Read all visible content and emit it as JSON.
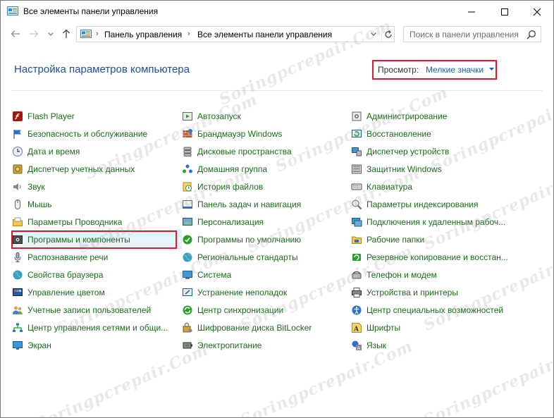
{
  "window": {
    "title": "Все элементы панели управления",
    "icon": "control-panel-icon"
  },
  "address_bar": {
    "breadcrumbs": [
      "Панель управления",
      "Все элементы панели управления"
    ],
    "search_placeholder": "Поиск в панели управления"
  },
  "header": {
    "title": "Настройка параметров компьютера",
    "view_label": "Просмотр:",
    "view_value": "Мелкие значки"
  },
  "columns": [
    [
      {
        "label": "Flash Player",
        "icon": "flash-player-icon"
      },
      {
        "label": "Безопасность и обслуживание",
        "icon": "flag-icon"
      },
      {
        "label": "Дата и время",
        "icon": "clock-icon"
      },
      {
        "label": "Диспетчер учетных данных",
        "icon": "credential-vault-icon"
      },
      {
        "label": "Звук",
        "icon": "speaker-icon"
      },
      {
        "label": "Мышь",
        "icon": "mouse-icon"
      },
      {
        "label": "Параметры Проводника",
        "icon": "folder-options-icon"
      },
      {
        "label": "Программы и компоненты",
        "icon": "programs-icon",
        "selected": true
      },
      {
        "label": "Распознавание речи",
        "icon": "microphone-icon"
      },
      {
        "label": "Свойства браузера",
        "icon": "globe-icon"
      },
      {
        "label": "Управление цветом",
        "icon": "color-management-icon"
      },
      {
        "label": "Учетные записи пользователей",
        "icon": "users-icon"
      },
      {
        "label": "Центр управления сетями и общи...",
        "icon": "network-icon"
      },
      {
        "label": "Экран",
        "icon": "display-icon"
      }
    ],
    [
      {
        "label": "Автозапуск",
        "icon": "autoplay-icon"
      },
      {
        "label": "Брандмауэр Windows",
        "icon": "firewall-icon"
      },
      {
        "label": "Дисковые пространства",
        "icon": "storage-spaces-icon"
      },
      {
        "label": "Домашняя группа",
        "icon": "homegroup-icon"
      },
      {
        "label": "История файлов",
        "icon": "file-history-icon"
      },
      {
        "label": "Панель задач и навигация",
        "icon": "taskbar-icon"
      },
      {
        "label": "Персонализация",
        "icon": "personalization-icon"
      },
      {
        "label": "Программы по умолчанию",
        "icon": "default-programs-icon"
      },
      {
        "label": "Региональные стандарты",
        "icon": "region-icon"
      },
      {
        "label": "Система",
        "icon": "system-icon"
      },
      {
        "label": "Устранение неполадок",
        "icon": "troubleshooting-icon"
      },
      {
        "label": "Центр синхронизации",
        "icon": "sync-center-icon"
      },
      {
        "label": "Шифрование диска BitLocker",
        "icon": "bitlocker-icon"
      },
      {
        "label": "Электропитание",
        "icon": "power-options-icon"
      }
    ],
    [
      {
        "label": "Администрирование",
        "icon": "admin-tools-icon"
      },
      {
        "label": "Восстановление",
        "icon": "recovery-icon"
      },
      {
        "label": "Диспетчер устройств",
        "icon": "device-manager-icon"
      },
      {
        "label": "Защитник Windows",
        "icon": "defender-icon"
      },
      {
        "label": "Клавиатура",
        "icon": "keyboard-icon"
      },
      {
        "label": "Параметры индексирования",
        "icon": "indexing-icon"
      },
      {
        "label": "Подключения к удаленным рабоч...",
        "icon": "remote-desktop-icon"
      },
      {
        "label": "Рабочие папки",
        "icon": "work-folders-icon"
      },
      {
        "label": "Резервное копирование и восстан...",
        "icon": "backup-restore-icon"
      },
      {
        "label": "Телефон и модем",
        "icon": "phone-modem-icon"
      },
      {
        "label": "Устройства и принтеры",
        "icon": "printer-icon"
      },
      {
        "label": "Центр специальных возможностей",
        "icon": "ease-of-access-icon"
      },
      {
        "label": "Шрифты",
        "icon": "fonts-icon"
      },
      {
        "label": "Язык",
        "icon": "language-icon"
      }
    ]
  ],
  "watermark": "Soringpcrepair.Com"
}
